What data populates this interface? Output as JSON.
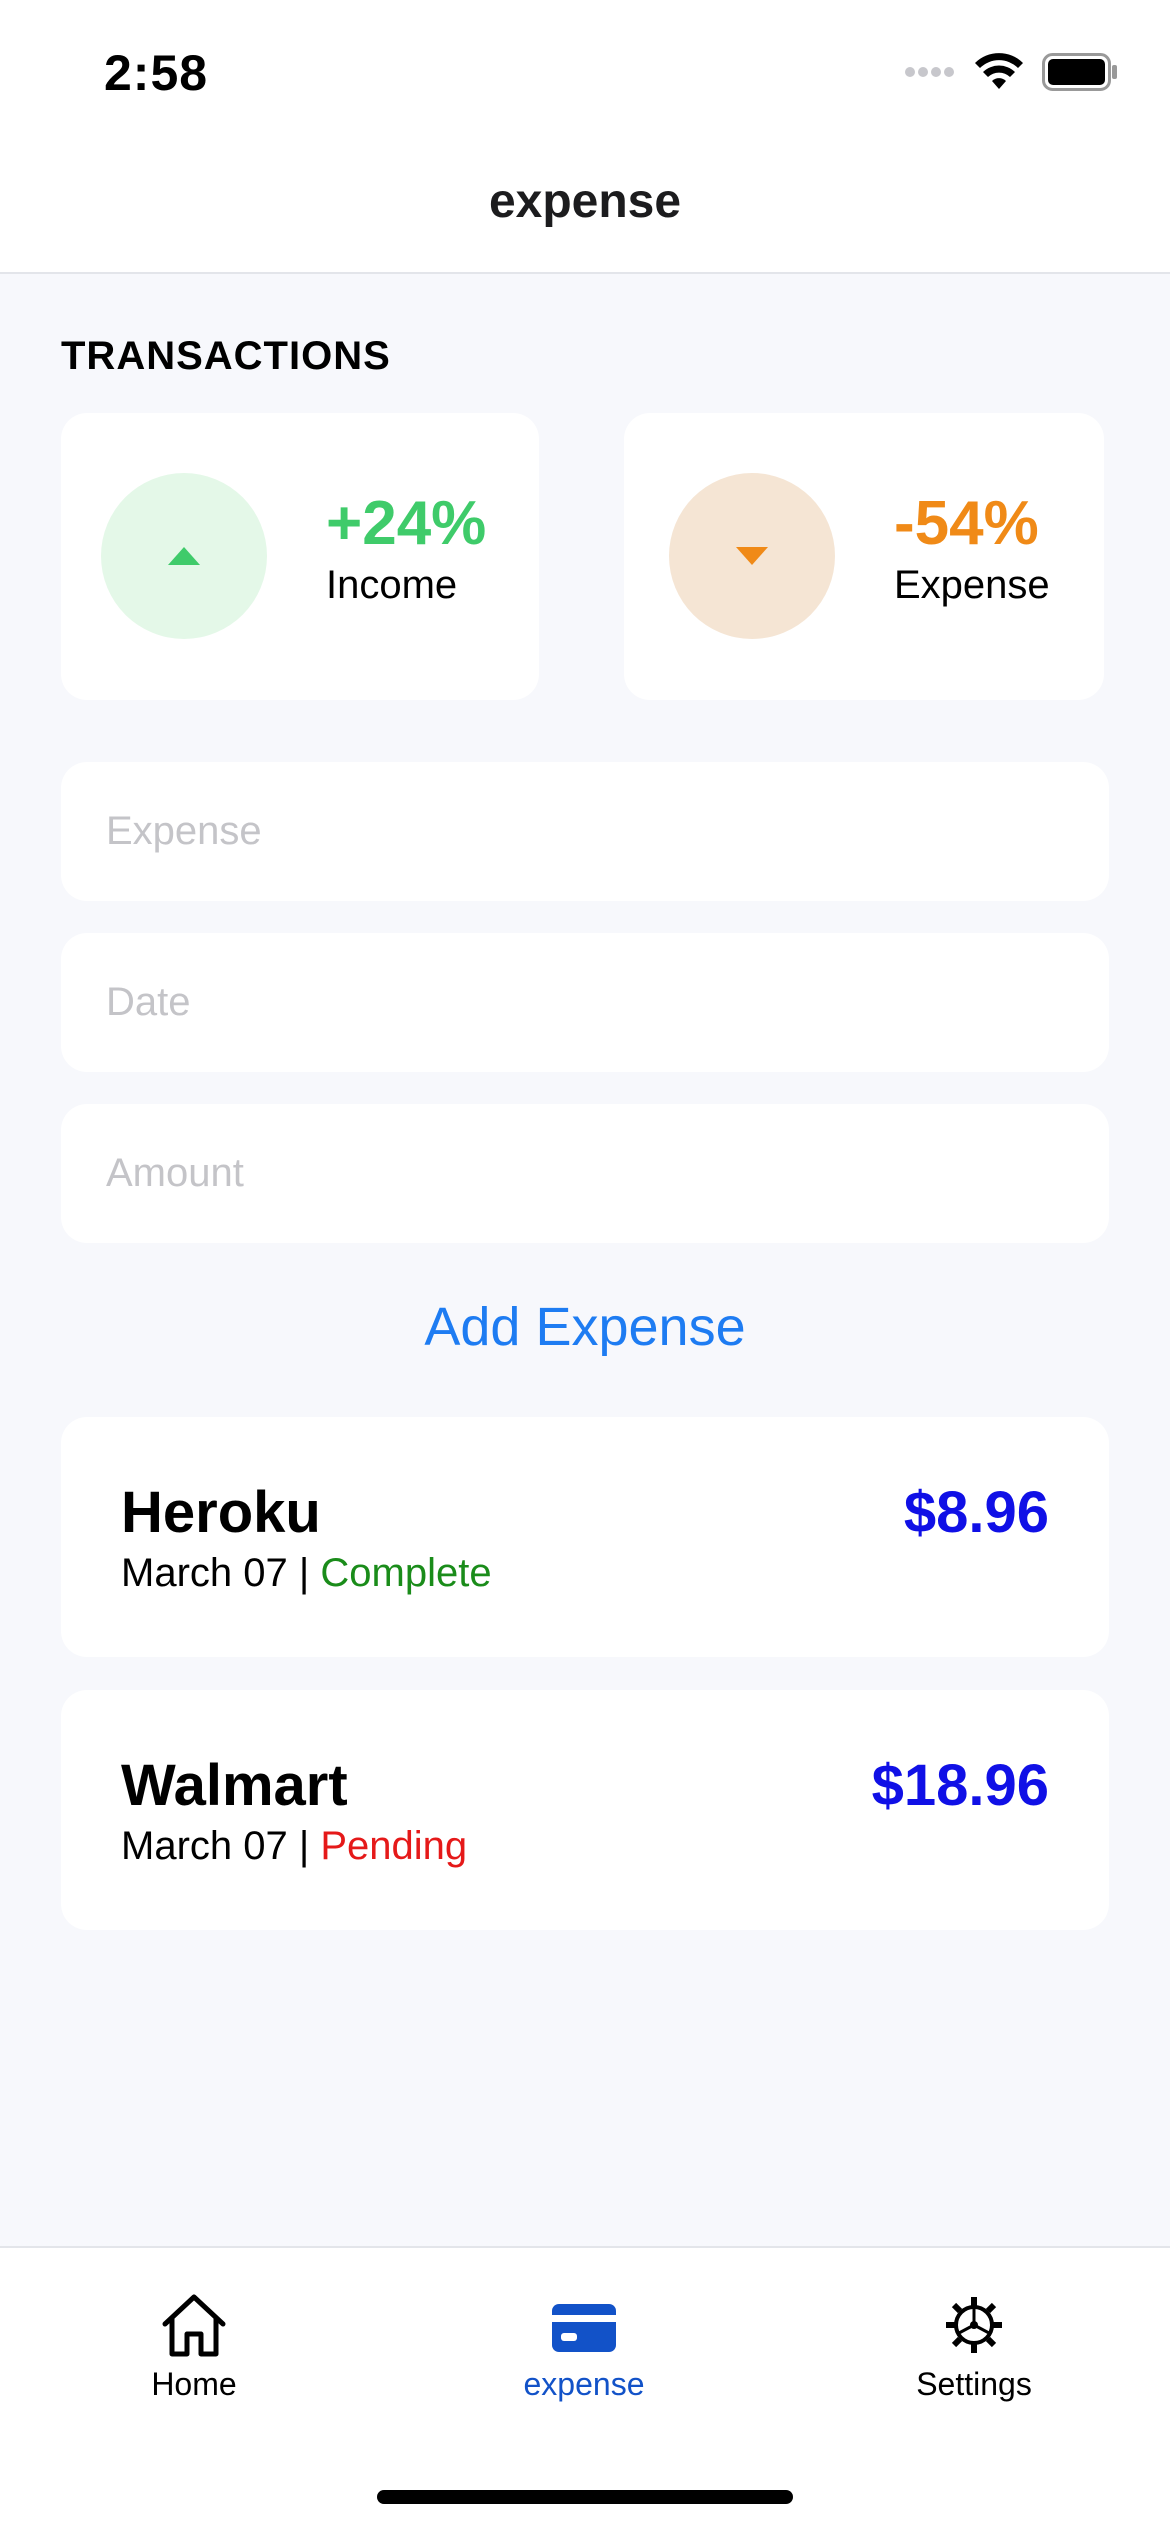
{
  "status_bar": {
    "time": "2:58"
  },
  "header": {
    "title": "expense"
  },
  "transactions": {
    "title": "TRANSACTIONS",
    "income": {
      "percent": "+24%",
      "label": "Income",
      "color": "#3FCB6A"
    },
    "expense": {
      "percent": "-54%",
      "label": "Expense",
      "color": "#F08A17"
    }
  },
  "form": {
    "expense_placeholder": "Expense",
    "date_placeholder": "Date",
    "amount_placeholder": "Amount",
    "add_label": "Add Expense"
  },
  "expenses": [
    {
      "name": "Heroku",
      "date": "March 07",
      "separator": " | ",
      "status": "Complete",
      "amount": "$8.96"
    },
    {
      "name": "Walmart",
      "date": "March 07",
      "separator": " | ",
      "status": "Pending",
      "amount": "$18.96"
    }
  ],
  "tabs": [
    {
      "label": "Home",
      "icon": "home-icon"
    },
    {
      "label": "expense",
      "icon": "credit-card-icon",
      "active": true
    },
    {
      "label": "Settings",
      "icon": "gear-icon"
    }
  ]
}
